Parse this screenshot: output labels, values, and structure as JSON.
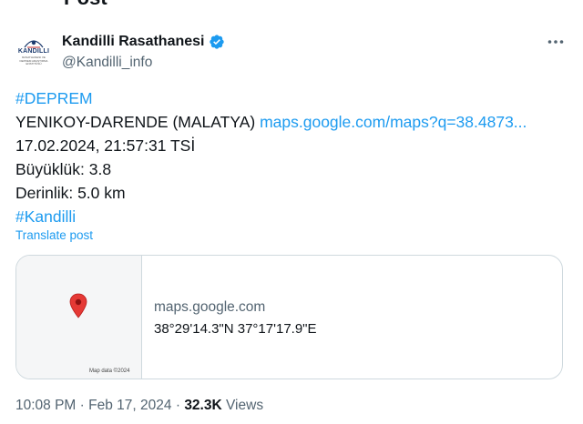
{
  "header": {
    "title": "Post"
  },
  "author": {
    "avatar": {
      "logo_text": "KANDILLI",
      "logo_subtext": "RASATHANESI VE DEPREM ARAŞTIRMA ENSTITÜSÜ",
      "icon": "observatory-logo"
    },
    "display_name": "Kandilli Rasathanesi",
    "handle": "@Kandilli_info",
    "verified": true,
    "verified_icon": "verified-badge-icon"
  },
  "post": {
    "lines": {
      "hashtag_1": "#DEPREM",
      "location": "YENIKOY-DARENDE (MALATYA)",
      "location_link": "maps.google.com/maps?q=38.4873...",
      "datetime": "17.02.2024, 21:57:31 TSİ",
      "magnitude": "Büyüklük: 3.8",
      "depth": "Derinlik: 5.0 km",
      "hashtag_2": "#Kandilli"
    },
    "translate_label": "Translate post"
  },
  "card": {
    "map_attribution": "Map data ©2024",
    "domain": "maps.google.com",
    "title": "38°29'14.3\"N 37°17'17.9\"E"
  },
  "meta": {
    "time": "10:08 PM",
    "separator": "·",
    "date": "Feb 17, 2024",
    "views_count": "32.3K",
    "views_label": "Views"
  },
  "colors": {
    "link": "#1d9bf0",
    "text": "#0f1419",
    "muted": "#536471",
    "border": "#cfd9de",
    "pin": "#e53935"
  }
}
